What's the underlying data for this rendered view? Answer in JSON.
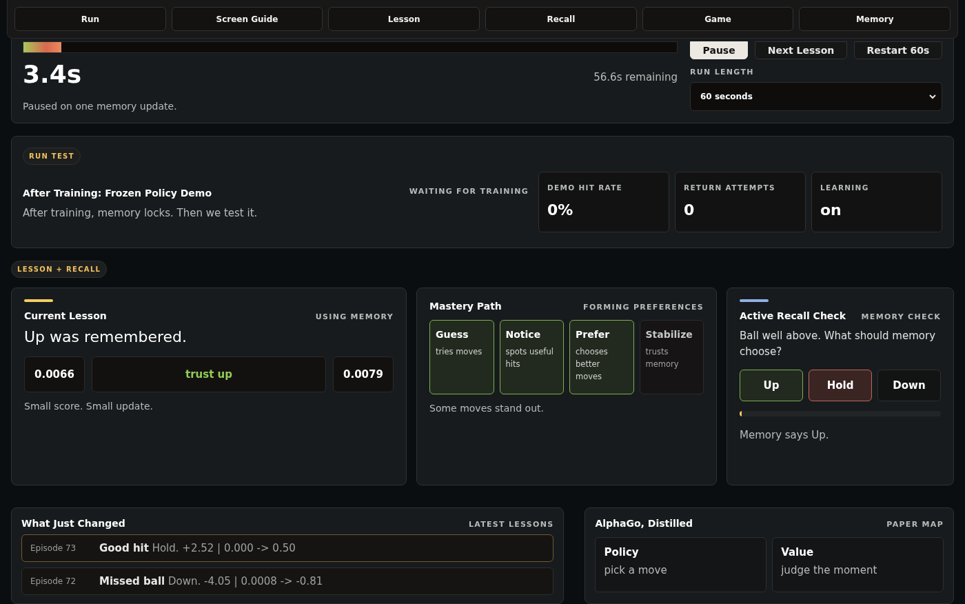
{
  "nav": [
    {
      "label": "Run"
    },
    {
      "label": "Screen Guide"
    },
    {
      "label": "Lesson"
    },
    {
      "label": "Recall"
    },
    {
      "label": "Game"
    },
    {
      "label": "Memory"
    }
  ],
  "run": {
    "progress": {
      "level": 0.058
    },
    "elapsed": "3.4s",
    "remaining": "56.6s remaining",
    "note": "Paused on one memory update.",
    "buttons": [
      {
        "label": "Pause",
        "kind": "primary"
      },
      {
        "label": "Next Lesson",
        "kind": "plain"
      },
      {
        "label": "Restart 60s",
        "kind": "plain"
      }
    ],
    "run_length": {
      "label": "RUN LENGTH",
      "value": "60 seconds"
    }
  },
  "run_test": {
    "badge": "RUN TEST",
    "title": "After Training: Frozen Policy Demo",
    "text": "After training, memory locks. Then we test it.",
    "status": "WAITING FOR TRAINING",
    "stats": [
      {
        "label": "DEMO HIT RATE",
        "value": "0%"
      },
      {
        "label": "RETURN ATTEMPTS",
        "value": "0"
      },
      {
        "label": "LEARNING",
        "value": "on"
      }
    ]
  },
  "section_badge": "LESSON + RECALL",
  "current_lesson": {
    "title": "Current Lesson",
    "status": "USING MEMORY",
    "headline": "Up was remembered.",
    "before": "0.0066",
    "change": "trust up",
    "after": "0.0079",
    "note": "Small score. Small update."
  },
  "mastery_path": {
    "title": "Mastery Path",
    "status": "FORMING PREFERENCES",
    "steps": [
      {
        "name": "Guess",
        "text": "tries moves",
        "reached": true
      },
      {
        "name": "Notice",
        "text": "spots useful hits",
        "reached": true
      },
      {
        "name": "Prefer",
        "text": "chooses better moves",
        "reached": true
      },
      {
        "name": "Stabilize",
        "text": "trusts memory",
        "reached": false
      }
    ],
    "note": "Some moves stand out."
  },
  "recall_check": {
    "title": "Active Recall Check",
    "status": "MEMORY CHECK",
    "question": "Ball well above. What should memory choose?",
    "options": [
      {
        "label": "Up",
        "kind": "correct"
      },
      {
        "label": "Hold",
        "kind": "wrong"
      },
      {
        "label": "Down",
        "kind": "plain"
      }
    ],
    "confidence": {
      "level": 0.005
    },
    "note": "Memory says Up."
  },
  "changes": {
    "title": "What Just Changed",
    "status": "LATEST LESSONS",
    "episodes": [
      {
        "episode": "Episode 73",
        "result": "Good hit",
        "detail": "Hold. +2.52 | 0.000 -> 0.50",
        "selected": true
      },
      {
        "episode": "Episode 72",
        "result": "Missed ball",
        "detail": "Down. -4.05 | 0.0008 -> -0.81",
        "selected": false
      }
    ]
  },
  "paper_map": {
    "title": "AlphaGo, Distilled",
    "status": "PAPER MAP",
    "items": [
      {
        "name": "Policy",
        "text": "pick a move"
      },
      {
        "name": "Value",
        "text": "judge the moment"
      }
    ]
  }
}
